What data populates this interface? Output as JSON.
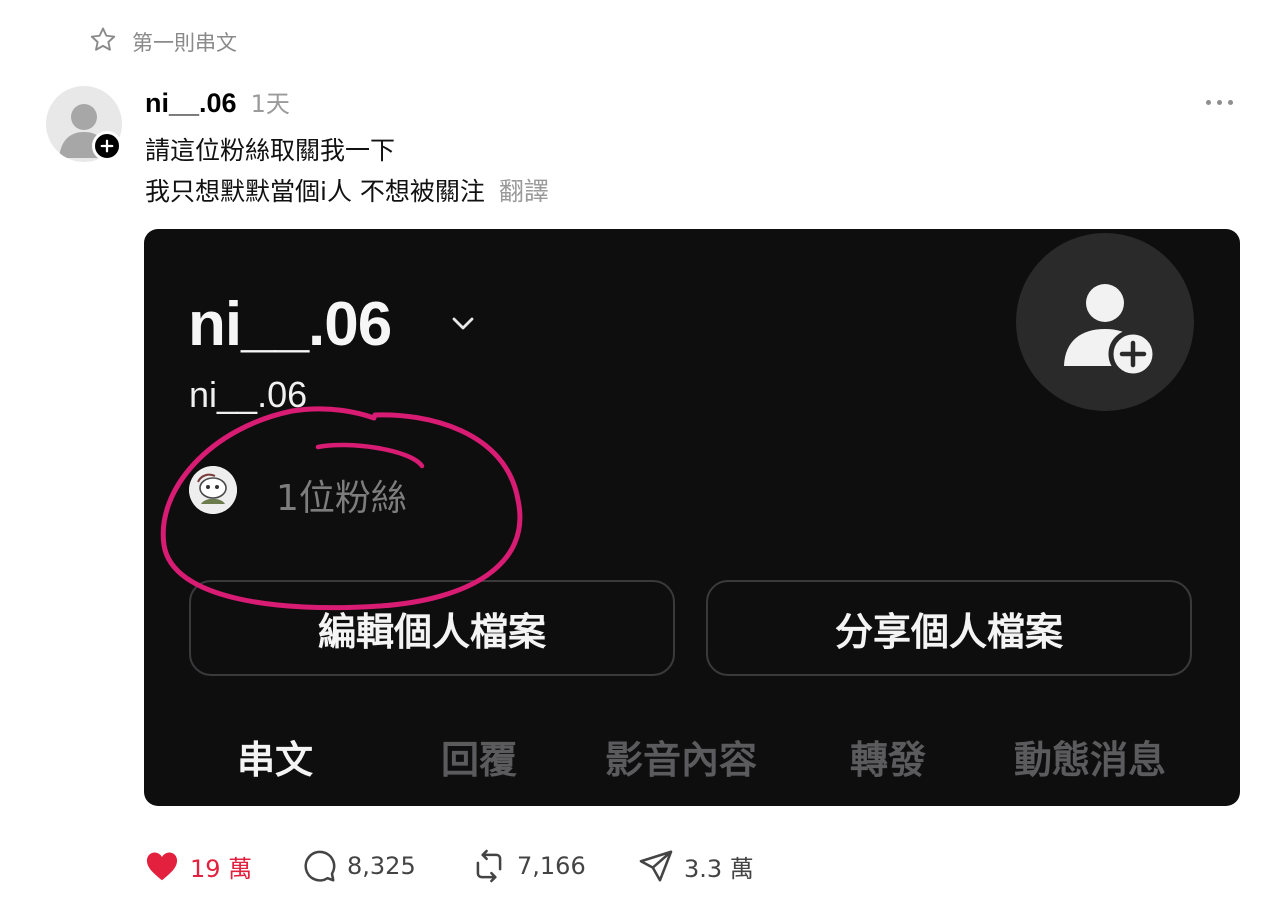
{
  "pinned_label": "第一則串文",
  "post": {
    "username": "ni__.06",
    "timestamp": "1天",
    "lines": [
      "請這位粉絲取關我一下",
      "我只想默默當個i人 不想被關注"
    ],
    "translate_label": "翻譯"
  },
  "embedded_profile": {
    "name": "ni__.06",
    "handle": "ni__.06",
    "followers_text": "1位粉絲",
    "buttons": [
      "編輯個人檔案",
      "分享個人檔案"
    ],
    "tabs": [
      {
        "label": "串文",
        "active": true
      },
      {
        "label": "回覆",
        "active": false
      },
      {
        "label": "影音內容",
        "active": false
      },
      {
        "label": "轉發",
        "active": false
      },
      {
        "label": "動態消息",
        "active": false
      }
    ],
    "annotation_color": "#d81b73"
  },
  "actions": {
    "likes": "19 萬",
    "comments": "8,325",
    "reposts": "7,166",
    "shares": "3.3 萬"
  },
  "colors": {
    "like": "#e3213f",
    "card_bg": "#0e0e0f",
    "muted": "#9a9a9a"
  },
  "icons": {
    "pinned": "star-icon",
    "more": "more-icon",
    "like": "heart-icon",
    "comment": "comment-icon",
    "repost": "repost-icon",
    "share": "send-icon",
    "follow": "plus-icon"
  }
}
